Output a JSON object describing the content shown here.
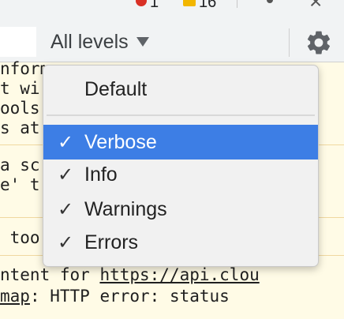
{
  "topbar": {
    "error_count": "1",
    "warning_count": "16"
  },
  "toolbar": {
    "levels_label": "All levels",
    "settings_icon": "gear-icon"
  },
  "console": {
    "lines": [
      "nform",
      "t wi",
      "ools",
      "s at",
      "a sc",
      "e' t",
      " too",
      "ntent for ",
      "map"
    ],
    "link_text": "https://api.clou",
    "error_tail": ": HTTP error: status"
  },
  "menu": {
    "default_label": "Default",
    "items": [
      {
        "label": "Verbose",
        "check": "✓"
      },
      {
        "label": "Info",
        "check": "✓"
      },
      {
        "label": "Warnings",
        "check": "✓"
      },
      {
        "label": "Errors",
        "check": "✓"
      }
    ]
  },
  "colors": {
    "selection": "#3d7ee5",
    "console_bg": "#fffbe6"
  }
}
